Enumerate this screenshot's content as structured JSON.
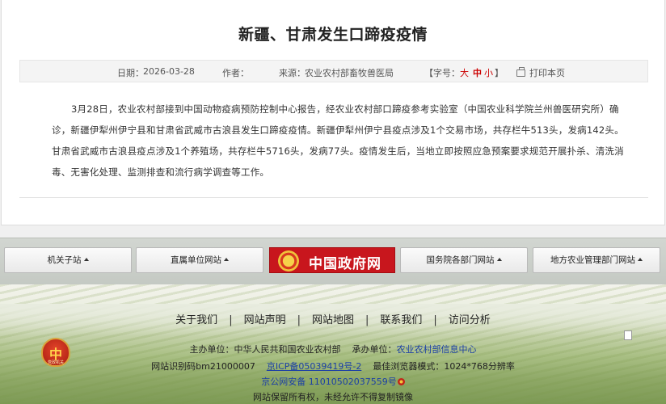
{
  "article": {
    "title": "新疆、甘肃发生口蹄疫疫情",
    "meta": {
      "date_label": "日期：",
      "date_value": "2026-03-28",
      "author_label": "作者：",
      "source_label": "来源：",
      "source_value": "农业农村部畜牧兽医局",
      "font_size_label": "【字号：",
      "size_large": "大",
      "size_medium": "中",
      "size_small": "小",
      "font_size_close": "】",
      "print_label": "打印本页"
    },
    "body": "3月28日，农业农村部接到中国动物疫病预防控制中心报告，经农业农村部口蹄疫参考实验室（中国农业科学院兰州兽医研究所）确诊，新疆伊犁州伊宁县和甘肃省武威市古浪县发生口蹄疫疫情。新疆伊犁州伊宁县疫点涉及1个交易市场，共存栏牛513头，发病142头。甘肃省武威市古浪县疫点涉及1个养殖场，共存栏牛5716头，发病77头。疫情发生后，当地立即按照应急预案要求规范开展扑杀、清洗消毒、无害化处理、监测排查和流行病学调查等工作。"
  },
  "nav": {
    "btn1": "机关子站",
    "btn2": "直属单位网站",
    "gov": "中国政府网",
    "btn4": "国务院各部门网站",
    "btn5": "地方农业管理部门网站"
  },
  "footer": {
    "links": [
      "关于我们",
      "网站声明",
      "网站地图",
      "联系我们",
      "访问分析"
    ],
    "separator": "|",
    "host_label": "主办单位：",
    "host_value": "中华人民共和国农业农村部",
    "operator_label": "承办单位：",
    "operator_value": "农业农村部信息中心",
    "site_id": "网站识别码bm21000007",
    "icp": "京ICP备05039419号-2",
    "browser": "最佳浏览器模式：1024*768分辨率",
    "police": "京公网安备 11010502037559号",
    "rights": "网站保留所有权，未经允许不得复制镜像",
    "badge_char": "中",
    "badge_caption": "党政机关"
  },
  "colors": {
    "gov_red": "#c8161d",
    "link_blue": "#1b3fa6",
    "accent_red": "#cc0000"
  }
}
